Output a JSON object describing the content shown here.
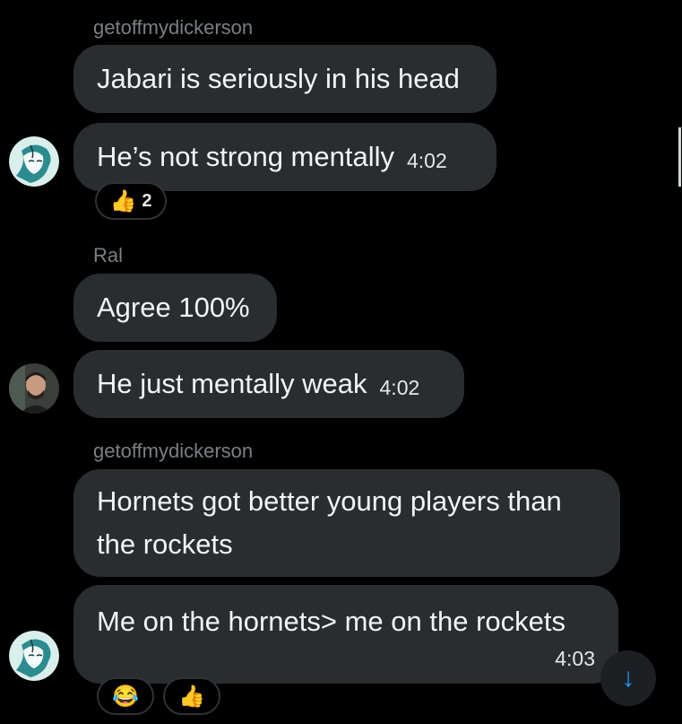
{
  "messages": {
    "group1": {
      "sender": "getoffmydickerson",
      "bubble1": "Jabari is seriously in his head",
      "bubble2": "He’s not strong mentally",
      "bubble2_time": "4:02",
      "reaction_emoji": "👍",
      "reaction_count": "2"
    },
    "group2": {
      "sender": "Ral",
      "bubble1": "Agree 100%",
      "bubble2": "He just mentally weak",
      "bubble2_time": "4:02"
    },
    "group3": {
      "sender": "getoffmydickerson",
      "bubble1_line1": "Hornets got better young players than",
      "bubble1_line2": "the rockets",
      "bubble2": "Me on the hornets> me on the rockets",
      "bubble2_time": "4:03",
      "reaction1_emoji": "😂",
      "reaction2_emoji": "👍"
    }
  },
  "scroll_button": {
    "icon": "arrow-down-icon",
    "glyph": "↓",
    "color": "#1d9bf0"
  },
  "colors": {
    "background": "#000000",
    "bubble": "#2a2d30",
    "sender": "#7b7f83"
  }
}
